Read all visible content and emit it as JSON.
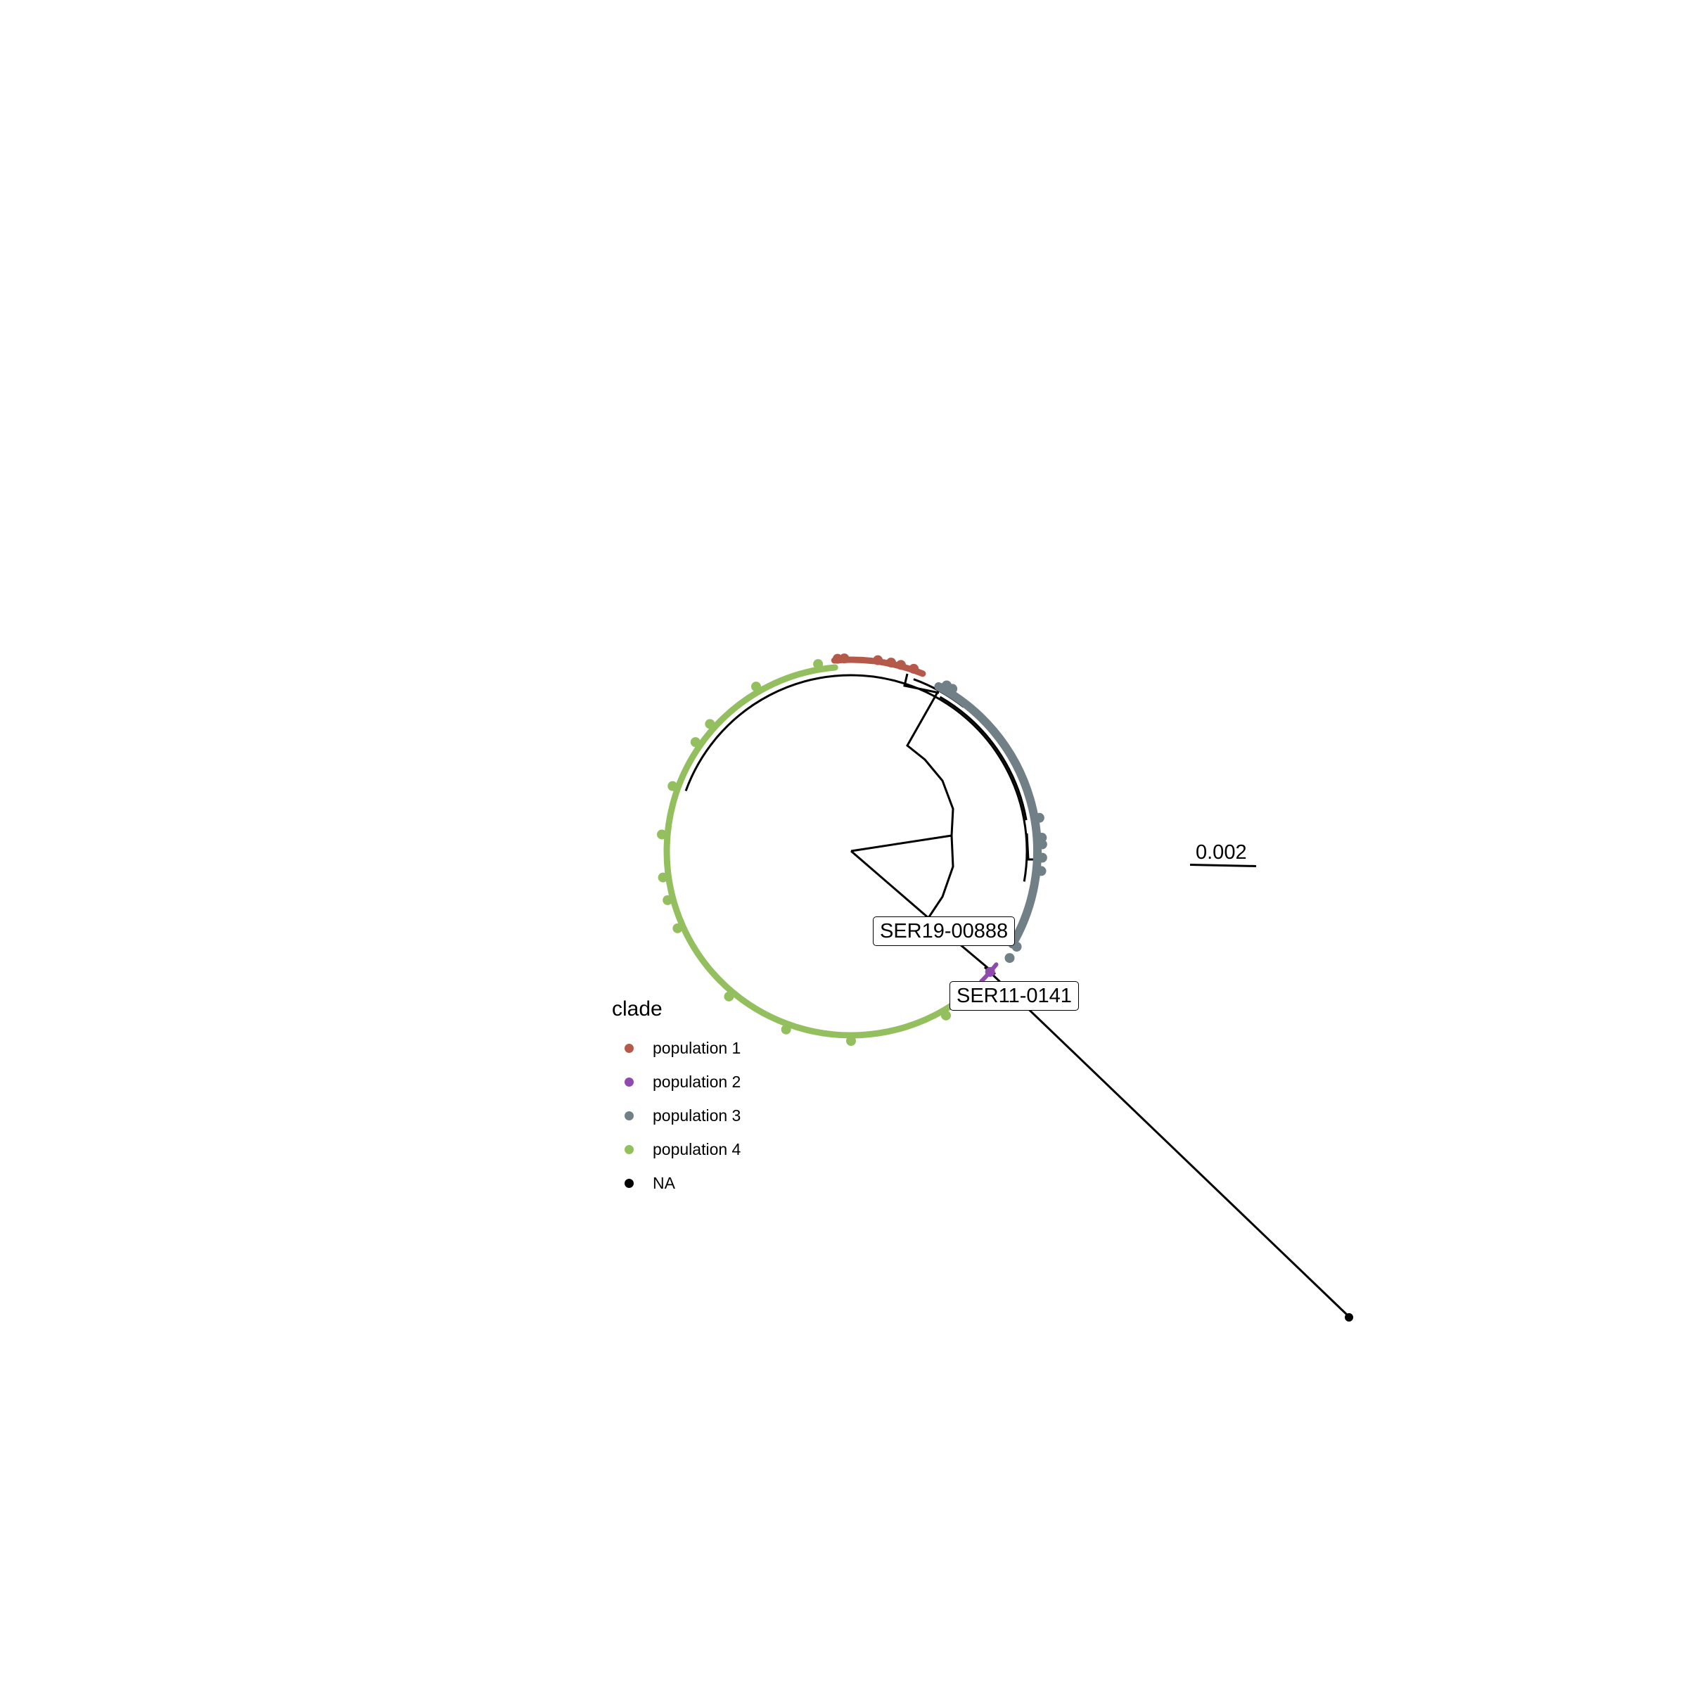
{
  "tip_labels": {
    "a": "SER19-00888",
    "b": "SER11-0141"
  },
  "scale_bar": {
    "label": "0.002"
  },
  "legend": {
    "title": "clade",
    "items": [
      {
        "label": "population 1",
        "color": "#b5594a"
      },
      {
        "label": "population 2",
        "color": "#8e4bad"
      },
      {
        "label": "population 3",
        "color": "#717f87"
      },
      {
        "label": "population 4",
        "color": "#93bf5f"
      },
      {
        "label": "NA",
        "color": "#000000"
      }
    ]
  },
  "colors": {
    "population_1": "#b5594a",
    "population_2": "#8e4bad",
    "population_3": "#717f87",
    "population_4": "#93bf5f",
    "branch": "#000000"
  }
}
